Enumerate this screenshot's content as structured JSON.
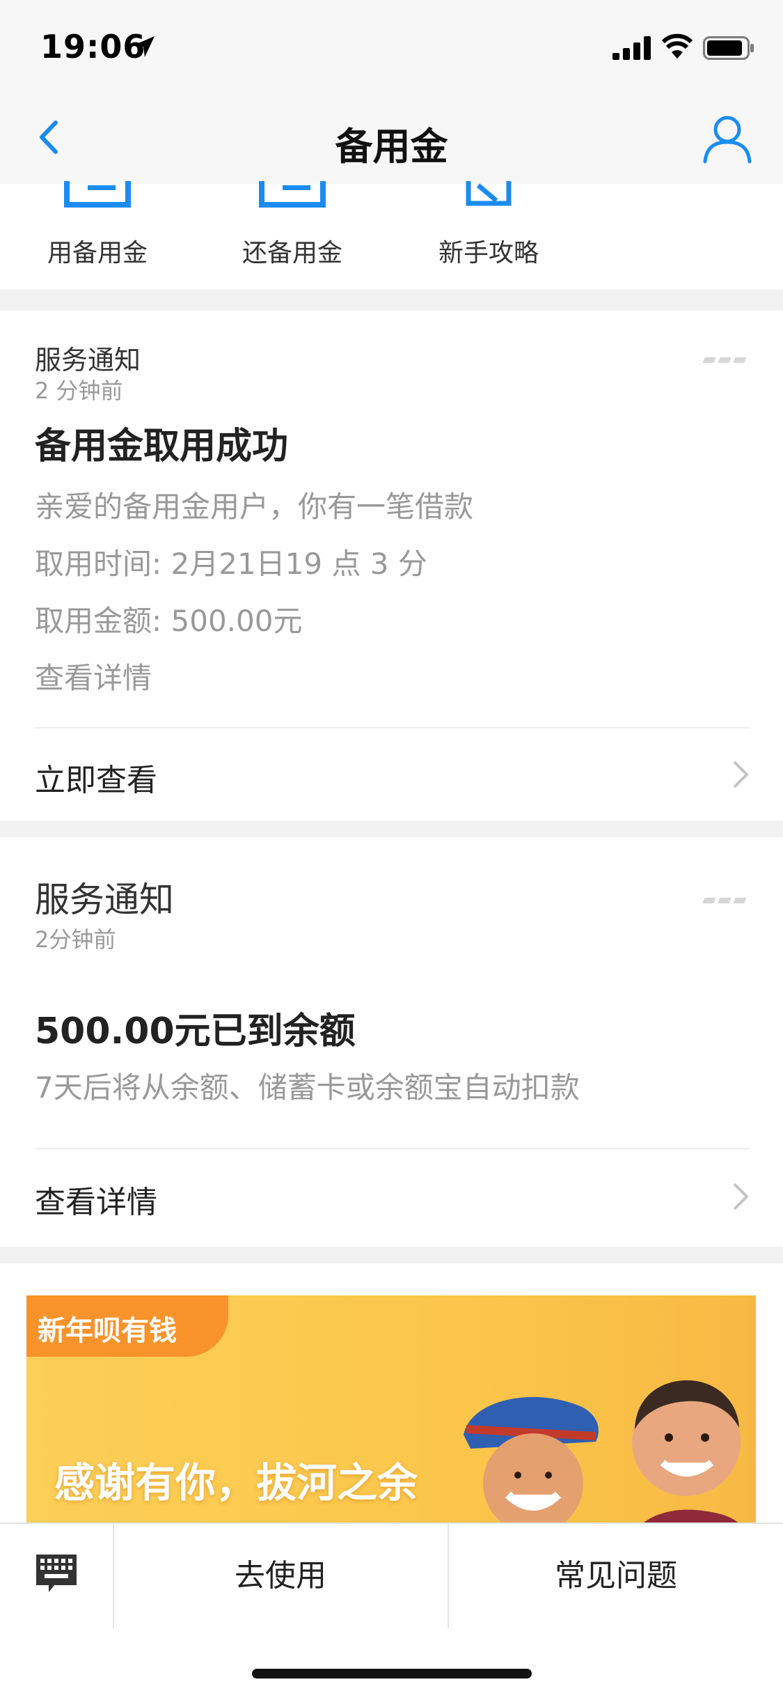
{
  "status_bar": {
    "time": "19:06"
  },
  "nav": {
    "title": "备用金"
  },
  "quick_actions": [
    {
      "label": "用备用金",
      "icon": "borrow-icon"
    },
    {
      "label": "还备用金",
      "icon": "repay-icon"
    },
    {
      "label": "新手攻略",
      "icon": "guide-icon"
    }
  ],
  "notice1": {
    "source": "服务通知",
    "time_ago": "2 分钟前",
    "title": "备用金取用成功",
    "lines": [
      "亲爱的备用金用户，你有一笔借款",
      "取用时间: 2月21日19 点 3 分",
      "取用金额: 500.00元",
      "查看详情"
    ],
    "action": "立即查看"
  },
  "notice2": {
    "source": "服务通知",
    "time_ago": "2分钟前",
    "title": "500.00元已到余额",
    "line": "7天后将从余额、储蓄卡或余额宝自动扣款",
    "action": "查看详情"
  },
  "banner": {
    "tag": "新年呗有钱",
    "headline": "感谢有你，拔河之余"
  },
  "tabbar": {
    "keyboard_icon": "keyboard-icon",
    "use": "去使用",
    "faq": "常见问题"
  },
  "colors": {
    "accent": "#1a8cf0",
    "muted": "#999999",
    "banner": "#fbc64a",
    "banner_tag": "#f7932a"
  }
}
